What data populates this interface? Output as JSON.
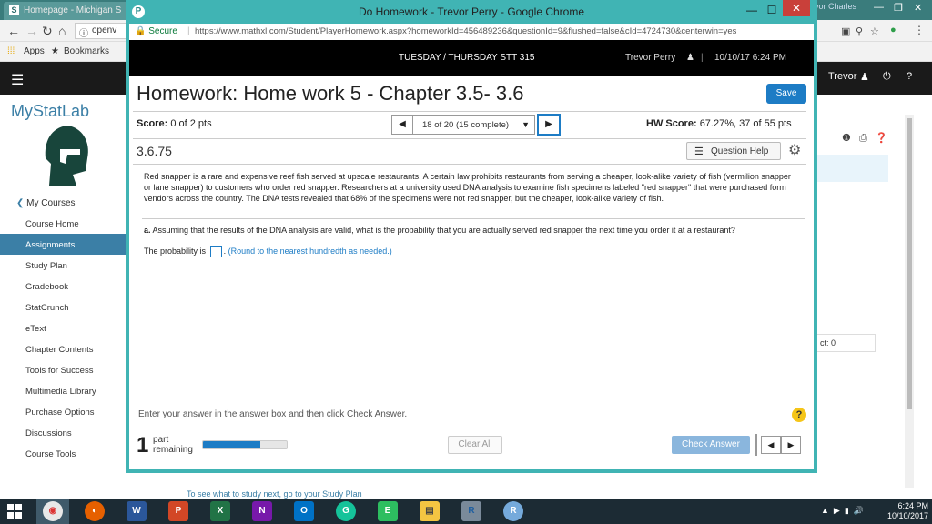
{
  "background": {
    "tab_title": "Homepage - Michigan S",
    "tab_favicon": "S",
    "chrome_user": "evor Charles",
    "omnibox_text": "openv",
    "bookmarks": {
      "apps": "Apps",
      "bookmarks": "Bookmarks"
    },
    "header_user": "Trevor",
    "logo": "MyStatLab",
    "my_courses": "My Courses",
    "menu": [
      "Course Home",
      "Assignments",
      "Study Plan",
      "Gradebook",
      "StatCrunch",
      "eText",
      "Chapter Contents",
      "Tools for Success",
      "Multimedia Library",
      "Purchase Options",
      "Discussions",
      "Course Tools"
    ],
    "active_menu_index": 1,
    "ct_text": "ct: 0",
    "bottom_link": "To see what to study next, go to your Study Plan"
  },
  "popup": {
    "window_title": "Do Homework - Trevor Perry - Google Chrome",
    "secure": "Secure",
    "url": "https://www.mathxl.com/Student/PlayerHomework.aspx?homeworkId=456489236&questionId=9&flushed=false&cId=4724730&centerwin=yes",
    "header": {
      "day": "TUESDAY / THURSDAY STT 315",
      "user": "Trevor Perry",
      "datetime": "10/10/17 6:24 PM"
    },
    "homework_title": "Homework: Home work 5 - Chapter 3.5- 3.6",
    "save_label": "Save",
    "score_label": "Score:",
    "score_value": "0 of 2 pts",
    "question_select": "18 of 20 (15 complete)",
    "hw_score_label": "HW Score:",
    "hw_score_value": "67.27%, 37 of 55 pts",
    "question_number": "3.6.75",
    "question_help": "Question Help",
    "problem_text": "Red snapper is a rare and expensive reef fish served at upscale restaurants. A certain law prohibits restaurants from serving a cheaper, look-alike variety of fish (vermilion snapper or lane snapper) to customers who order red snapper. Researchers at a university used DNA analysis to examine fish specimens labeled \"red snapper\" that were purchased form vendors across the country. The DNA tests revealed that 68% of the specimens were not red snapper, but the cheaper, look-alike variety of fish.",
    "part_a_label": "a.",
    "part_a_text": "Assuming that the results of the DNA analysis are valid, what is the probability that you are actually served red snapper the next time you order it at a restaurant?",
    "answer_prefix": "The probability is",
    "answer_hint": "(Round to the nearest hundredth as needed.)",
    "enter_answer": "Enter your answer in the answer box and then click Check Answer.",
    "help_icon": "?",
    "parts_remaining_count": "1",
    "parts_remaining_label_1": "part",
    "parts_remaining_label_2": "remaining",
    "progress_fraction": 0.68,
    "clear_all": "Clear All",
    "check_answer": "Check Answer"
  },
  "taskbar": {
    "apps": [
      "chrome-icon",
      "firefox-icon",
      "word-icon",
      "powerpoint-icon",
      "excel-icon",
      "onenote-icon",
      "outlook-icon",
      "grammarly-icon",
      "evernote-icon",
      "file-explorer-icon",
      "r-icon",
      "rstudio-icon"
    ],
    "time": "6:24 PM",
    "date": "10/10/2017"
  },
  "colors": {
    "popup_frame": "#40b4b4",
    "accent_blue": "#1d7cc5",
    "sidebar_active": "#3b7fa6",
    "taskbar": "#1c2b34"
  }
}
